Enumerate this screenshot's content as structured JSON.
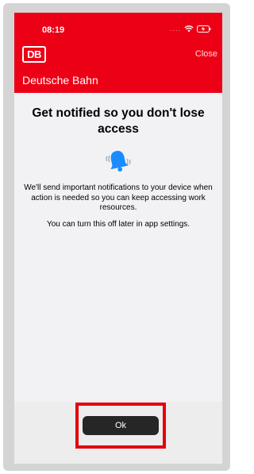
{
  "status_bar": {
    "time": "08:19",
    "signal": "....",
    "icons": [
      "wifi-icon",
      "battery-charging-icon"
    ]
  },
  "header": {
    "logo_text": "DB",
    "close_label": "Close",
    "org_name": "Deutsche Bahn",
    "background_color": "#ec0016"
  },
  "content": {
    "title": "Get notified so you don't lose access",
    "icon": "bell-icon",
    "body": "We'll send important notifications to your device when action is needed so you can keep accessing work resources.",
    "hint": "You can turn this off later in app settings."
  },
  "footer": {
    "ok_label": "Ok",
    "highlight_color": "#e5000b"
  }
}
